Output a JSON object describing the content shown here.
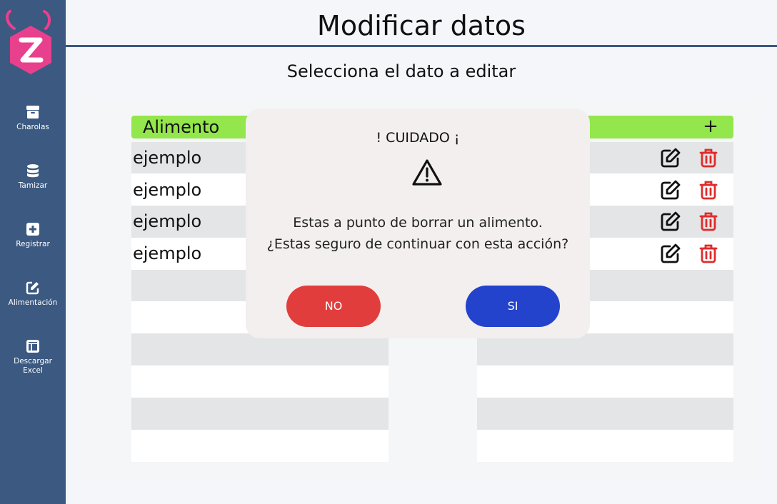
{
  "colors": {
    "sidebar_bg": "#3b5981",
    "header_green": "#93e64b",
    "logo_pink": "#e8408d",
    "delete_red": "#e02b2b",
    "btn_no": "#e23d3d",
    "btn_si": "#2343cc",
    "modal_bg": "#f3efef"
  },
  "sidebar": {
    "logo_letter": "Z",
    "items": [
      {
        "label": "Charolas",
        "icon": "archive-icon"
      },
      {
        "label": "Tamizar",
        "icon": "database-icon"
      },
      {
        "label": "Registrar",
        "icon": "plus-square-icon"
      },
      {
        "label": "Alimentación",
        "icon": "edit-square-icon"
      },
      {
        "label": "Descargar Excel",
        "icon": "layout-icon"
      }
    ]
  },
  "header": {
    "title": "Modificar datos",
    "subtitle": "Selecciona el dato a editar"
  },
  "table": {
    "column_header": "Alimento",
    "add_label": "+",
    "rows": [
      "ejemplo",
      "ejemplo",
      "ejemplo",
      "ejemplo"
    ]
  },
  "modal": {
    "title": "! CUIDADO ¡",
    "message_line1": "Estas a punto de borrar un alimento.",
    "message_line2": "¿Estas seguro de continuar con esta acción?",
    "no_label": "NO",
    "si_label": "SI"
  }
}
